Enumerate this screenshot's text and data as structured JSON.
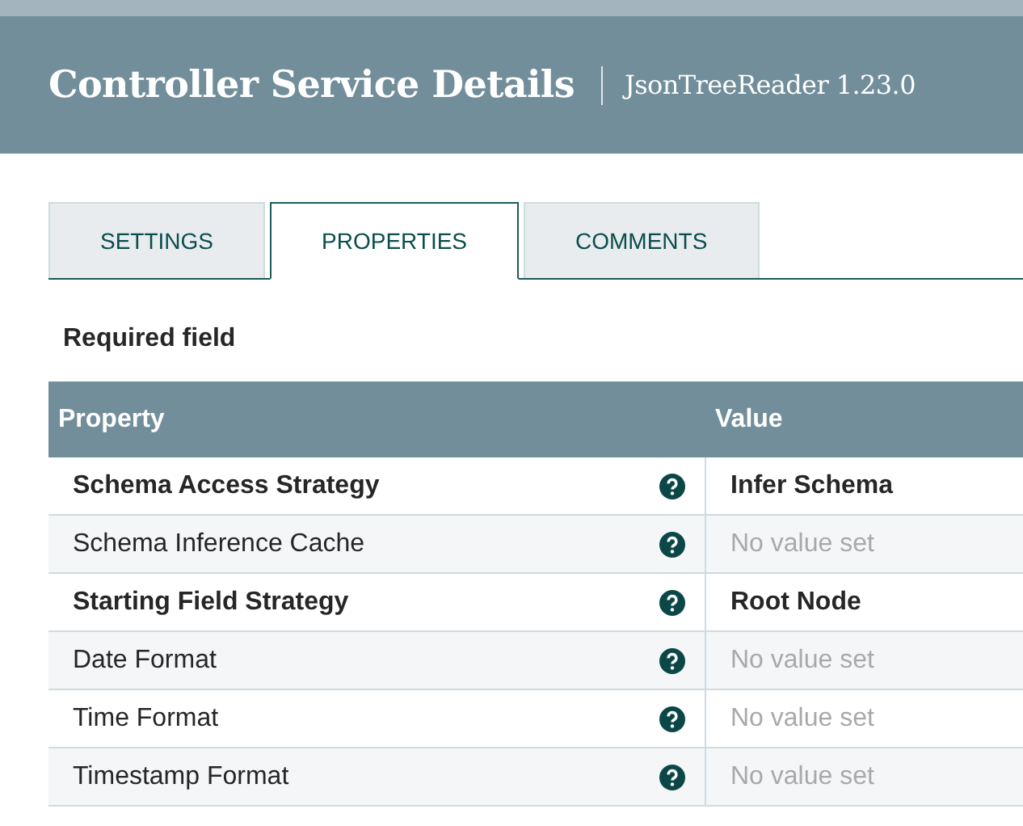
{
  "header": {
    "title": "Controller Service Details",
    "subtitle": "JsonTreeReader 1.23.0"
  },
  "tabs": [
    {
      "label": "SETTINGS",
      "selected": false
    },
    {
      "label": "PROPERTIES",
      "selected": true
    },
    {
      "label": "COMMENTS",
      "selected": false
    }
  ],
  "required_note": "Required field",
  "table": {
    "columns": [
      "Property",
      "Value"
    ],
    "rows": [
      {
        "property": "Schema Access Strategy",
        "required": true,
        "value": "Infer Schema",
        "value_set": true
      },
      {
        "property": "Schema Inference Cache",
        "required": false,
        "value": "No value set",
        "value_set": false
      },
      {
        "property": "Starting Field Strategy",
        "required": true,
        "value": "Root Node",
        "value_set": true
      },
      {
        "property": "Date Format",
        "required": false,
        "value": "No value set",
        "value_set": false
      },
      {
        "property": "Time Format",
        "required": false,
        "value": "No value set",
        "value_set": false
      },
      {
        "property": "Timestamp Format",
        "required": false,
        "value": "No value set",
        "value_set": false
      }
    ]
  }
}
